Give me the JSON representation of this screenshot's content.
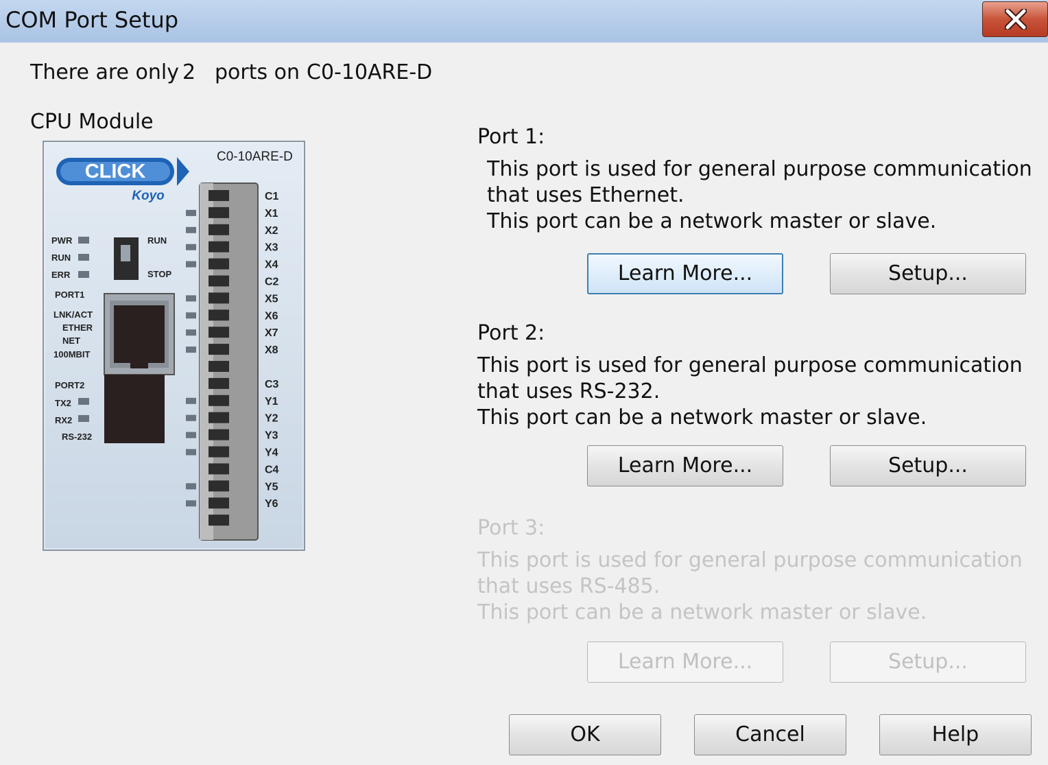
{
  "window": {
    "title": "COM Port Setup"
  },
  "header": {
    "prefix": "There are only",
    "count": "2",
    "middle": "ports on",
    "model": "C0-10ARE-D"
  },
  "cpu_module": {
    "label": "CPU Module",
    "model": "C0-10ARE-D",
    "brand": "CLICK",
    "maker": "Koyo",
    "switch_labels": [
      "RUN",
      "STOP"
    ],
    "led_labels": [
      "PWR",
      "RUN",
      "ERR"
    ],
    "port1_labels": [
      "PORT1",
      "LNK/ACT",
      "ETHER",
      "NET",
      "100MBIT"
    ],
    "port2_labels": [
      "PORT2",
      "TX2",
      "RX2",
      "RS-232"
    ],
    "terminals": [
      "C1",
      "X1",
      "X2",
      "X3",
      "X4",
      "C2",
      "X5",
      "X6",
      "X7",
      "X8",
      "",
      "C3",
      "Y1",
      "Y2",
      "Y3",
      "Y4",
      "C4",
      "Y5",
      "Y6"
    ]
  },
  "ports": [
    {
      "title": "Port 1:",
      "lines": [
        "This port is used for general purpose communication",
        "that uses Ethernet.",
        "This port can be a network master or slave."
      ],
      "learn_label": "Learn More...",
      "setup_label": "Setup...",
      "enabled": true
    },
    {
      "title": "Port 2:",
      "lines": [
        "This port is used for general purpose communication",
        "that uses RS-232.",
        "This port can be a network master or slave."
      ],
      "learn_label": "Learn More...",
      "setup_label": "Setup...",
      "enabled": true
    },
    {
      "title": "Port 3:",
      "lines": [
        "This port is used for general purpose communication",
        "that uses RS-485.",
        "This port can be a network master or slave."
      ],
      "learn_label": "Learn More...",
      "setup_label": "Setup...",
      "enabled": false
    }
  ],
  "footer": {
    "ok_label": "OK",
    "cancel_label": "Cancel",
    "help_label": "Help"
  }
}
